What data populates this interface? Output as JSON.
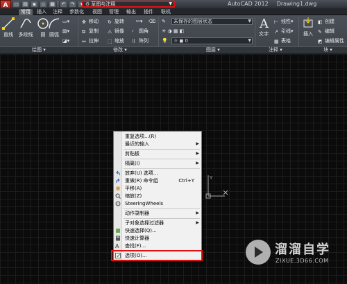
{
  "titlebar": {
    "app_button": "A",
    "workspace": "草图与注释",
    "app_name": "AutoCAD 2012",
    "file_name": "Drawing1.dwg"
  },
  "tabs": [
    "常用",
    "插入",
    "注释",
    "参数化",
    "视图",
    "管理",
    "输出",
    "插件",
    "联机"
  ],
  "ribbon": {
    "draw": {
      "line": "直线",
      "polyline": "多段线",
      "circle": "圆",
      "arc": "圆弧",
      "title": "绘图"
    },
    "modify": {
      "move": "移动",
      "rotate": "旋转",
      "copy": "复制",
      "mirror": "镜像",
      "fillet": "圆角",
      "stretch": "拉伸",
      "scale": "缩放",
      "array": "阵列",
      "title": "修改"
    },
    "layers": {
      "layer_state": "未保存的图层状态",
      "current_layer": "0",
      "title": "图层"
    },
    "annotation": {
      "text": "文字",
      "linear": "线性",
      "leader": "引线",
      "table": "表格",
      "title": "注释"
    },
    "block": {
      "insert": "插入",
      "create": "创建",
      "edit": "编辑",
      "edit_attributes": "编辑属性",
      "title": "块"
    }
  },
  "context_menu": {
    "items": [
      {
        "label": "重复选项...(R)",
        "submenu": false
      },
      {
        "label": "最近的输入",
        "submenu": true
      },
      {
        "label": "剪贴板",
        "submenu": true
      },
      {
        "label": "隔离(I)",
        "submenu": true
      },
      {
        "label": "放弃(U) 选项...",
        "submenu": false
      },
      {
        "label": "重做(R) 命令组",
        "shortcut": "Ctrl+Y",
        "submenu": false
      },
      {
        "label": "平移(A)",
        "submenu": false
      },
      {
        "label": "缩放(Z)",
        "submenu": false
      },
      {
        "label": "SteeringWheels",
        "submenu": false
      },
      {
        "label": "动作录制器",
        "submenu": true
      },
      {
        "label": "子对象选择过滤器",
        "submenu": true
      },
      {
        "label": "快速选择(Q)...",
        "submenu": false
      },
      {
        "label": "快速计算器",
        "submenu": false
      },
      {
        "label": "查找(F)...",
        "submenu": false
      },
      {
        "label": "选项(O)...",
        "submenu": false
      }
    ]
  },
  "ucs": {
    "y_label": "Y"
  },
  "watermark": {
    "brand": "溜溜自学",
    "url": "ZIXUE.3D66.COM"
  },
  "colors": {
    "highlight": "#e01010",
    "canvas": "#0b0b0b",
    "ribbon": "#464c53"
  }
}
